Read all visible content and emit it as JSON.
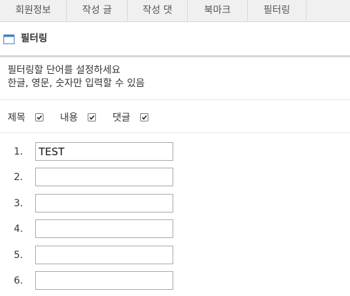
{
  "tabs": [
    {
      "label": "회원정보"
    },
    {
      "label": "작성 글"
    },
    {
      "label": "작성 댓"
    },
    {
      "label": "북마크"
    },
    {
      "label": "필터링"
    }
  ],
  "section": {
    "title": "필터링",
    "icon": "window-icon"
  },
  "description": {
    "line1": "필터링할 단어를 설정하세요",
    "line2": "한글, 영문, 숫자만 입력할 수 있음"
  },
  "targets": [
    {
      "label": "제목",
      "checked": true
    },
    {
      "label": "내용",
      "checked": true
    },
    {
      "label": "댓글",
      "checked": true
    }
  ],
  "filters": [
    {
      "number": "1.",
      "value": "TEST"
    },
    {
      "number": "2.",
      "value": ""
    },
    {
      "number": "3.",
      "value": ""
    },
    {
      "number": "4.",
      "value": ""
    },
    {
      "number": "5.",
      "value": ""
    },
    {
      "number": "6.",
      "value": ""
    }
  ],
  "colors": {
    "tab_bg": "#f0f0f0",
    "icon_blue": "#4a7fc1",
    "border": "#a9a9a9"
  }
}
